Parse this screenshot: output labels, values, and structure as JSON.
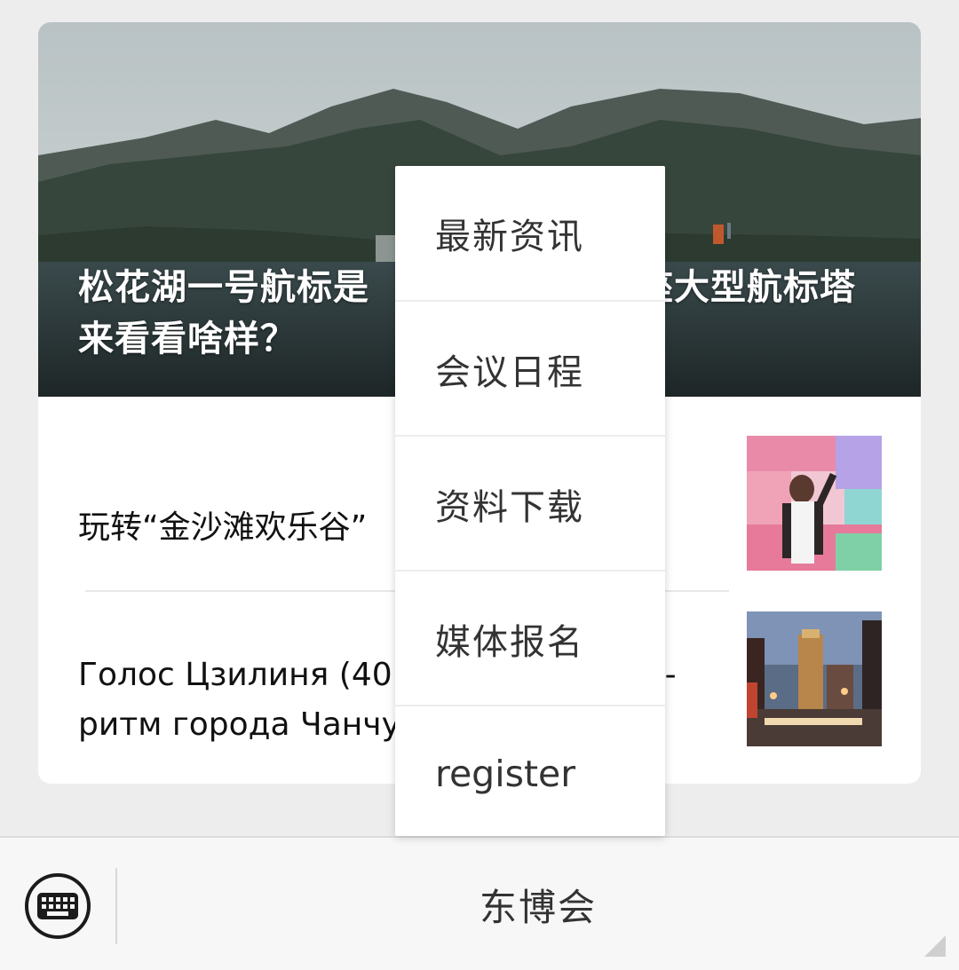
{
  "article": {
    "hero_title": "松花湖一号航标是 座大型航标塔来看看啥样？",
    "hero_title_line1": "松花湖一号航标是",
    "hero_title_line1_end": "座大型航标塔",
    "hero_title_line2": "来看看啥样？",
    "items": [
      {
        "text": "玩转“金沙滩欢乐谷”"
      },
      {
        "text_line1": "Голос Цзилиня (40",
        "text_line1_end": "-",
        "text_line2": "ритм города Чанчу"
      }
    ]
  },
  "popup_menu": {
    "items": [
      {
        "label": "最新资讯"
      },
      {
        "label": "会议日程"
      },
      {
        "label": "资料下载"
      },
      {
        "label": "媒体报名"
      },
      {
        "label": "register"
      }
    ]
  },
  "bottom_bar": {
    "keyboard_icon": "keyboard-icon",
    "menu_label": "东博会"
  },
  "colors": {
    "background": "#ededed",
    "card": "#ffffff",
    "text": "#111111",
    "menu_text": "#333333"
  }
}
